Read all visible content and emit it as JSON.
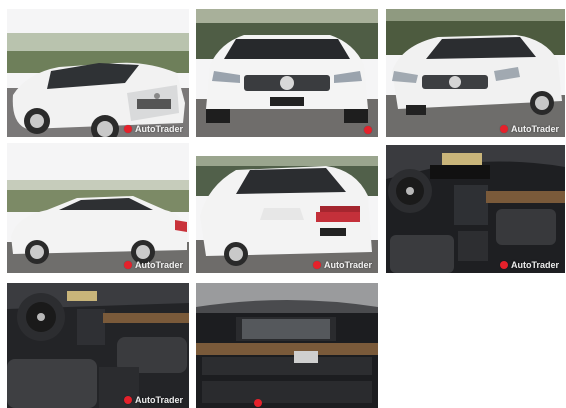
{
  "gallery": {
    "watermark_text": "AutoTrader",
    "watermark_logo_icon": "autotrader-logo-icon",
    "accent_color": "#e5212b",
    "photos": [
      {
        "subject": "front-left exterior, white sedan"
      },
      {
        "subject": "front exterior, white sedan"
      },
      {
        "subject": "front-right exterior, white sedan"
      },
      {
        "subject": "side exterior, white sedan"
      },
      {
        "subject": "rear-left exterior, white sedan"
      },
      {
        "subject": "dashboard and steering wheel"
      },
      {
        "subject": "interior front seats and console"
      },
      {
        "subject": "center console display"
      }
    ]
  }
}
